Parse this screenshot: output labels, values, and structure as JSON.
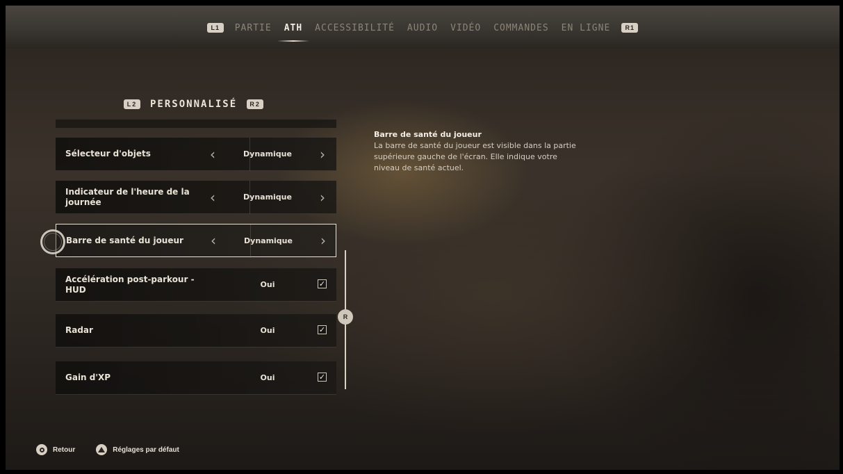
{
  "topbar": {
    "left_bumper": "L1",
    "right_bumper": "R1",
    "tabs": [
      {
        "label": "PARTIE",
        "active": false
      },
      {
        "label": "ATH",
        "active": true
      },
      {
        "label": "ACCESSIBILITÉ",
        "active": false
      },
      {
        "label": "AUDIO",
        "active": false
      },
      {
        "label": "VIDÉO",
        "active": false
      },
      {
        "label": "COMMANDES",
        "active": false
      },
      {
        "label": "EN LIGNE",
        "active": false
      }
    ]
  },
  "category": {
    "left_trigger": "L2",
    "title": "PERSONNALISÉ",
    "right_trigger": "R2"
  },
  "settings": [
    {
      "label": "Sélecteur d'objets",
      "type": "selector",
      "value": "Dynamique"
    },
    {
      "label": "Indicateur de l'heure de la journée",
      "type": "selector",
      "value": "Dynamique"
    },
    {
      "label": "Barre de santé du joueur",
      "type": "selector",
      "value": "Dynamique",
      "selected": true
    },
    {
      "label": "Accélération post-parkour - HUD",
      "type": "toggle",
      "value": "Oui",
      "checked": true
    },
    {
      "label": "Radar",
      "type": "toggle",
      "value": "Oui",
      "checked": true
    },
    {
      "label": "Gain d'XP",
      "type": "toggle",
      "value": "Oui",
      "checked": true
    }
  ],
  "arrows": {
    "left": "‹",
    "right": "›",
    "check": "✓"
  },
  "scroll_handle_label": "R",
  "description": {
    "title": "Barre de santé du joueur",
    "body": "La barre de santé du joueur est visible dans la partie supérieure gauche de l'écran. Elle indique votre niveau de santé actuel."
  },
  "footer": {
    "back_label": "Retour",
    "defaults_label": "Réglages par défaut"
  }
}
